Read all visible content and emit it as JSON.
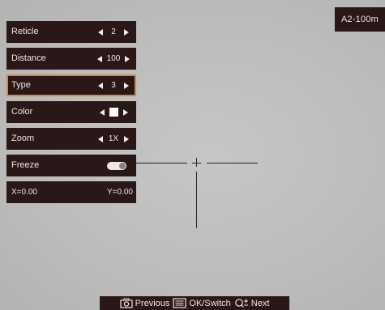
{
  "profile_badge": "A2-100m",
  "menu": {
    "reticle": {
      "label": "Reticle",
      "value": "2"
    },
    "distance": {
      "label": "Distance",
      "value": "100"
    },
    "type": {
      "label": "Type",
      "value": "3"
    },
    "color": {
      "label": "Color",
      "swatch": "#ffffff"
    },
    "zoom": {
      "label": "Zoom",
      "value": "1X"
    },
    "freeze": {
      "label": "Freeze",
      "state": "off"
    },
    "coords": {
      "x": "X=0.00",
      "y": "Y=0.00"
    }
  },
  "hint_bar": {
    "previous": "Previous",
    "ok_switch": "OK/Switch",
    "next": "Next",
    "icons": [
      "camera-icon",
      "menu-icon",
      "zoom-icon"
    ]
  },
  "colors": {
    "panel_bg": "#2a1717",
    "selection_outline": "#d18a3f",
    "viewport_bg": "#bdbdbd"
  }
}
